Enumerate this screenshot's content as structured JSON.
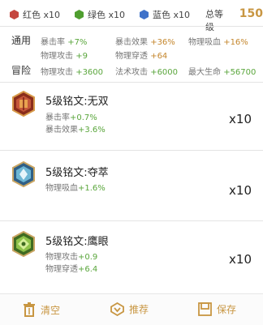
{
  "gems": [
    {
      "label": "红色 x10",
      "color": "#c5463f"
    },
    {
      "label": "绿色 x10",
      "color": "#4f9e2f"
    },
    {
      "label": "蓝色 x10",
      "color": "#3f72c9"
    }
  ],
  "total": {
    "label": "总等级",
    "value": "150"
  },
  "stats": {
    "general_label": "通用",
    "adventure_label": "冒险",
    "row1": [
      {
        "name": "暴击率 ",
        "value": "+7%"
      },
      {
        "name": "暴击效果 ",
        "value": "+36%"
      },
      {
        "name": "物理吸血 ",
        "value": "+16%"
      }
    ],
    "row2": [
      {
        "name": "物理攻击 ",
        "value": "+9"
      },
      {
        "name": "物理穿透 ",
        "value": "+64"
      }
    ],
    "row3": [
      {
        "name": "物理攻击 ",
        "value": "+3600"
      },
      {
        "name": "法术攻击 ",
        "value": "+6000"
      },
      {
        "name": "最大生命 ",
        "value": "+56700"
      }
    ]
  },
  "runes": [
    {
      "title": "5级铭文:无双",
      "count": "x10",
      "lines": [
        {
          "name": "暴击率",
          "value": "+0.7%"
        },
        {
          "name": "暴击效果",
          "value": "+3.6%"
        }
      ]
    },
    {
      "title": "5级铭文:夺萃",
      "count": "x10",
      "lines": [
        {
          "name": "物理吸血",
          "value": "+1.6%"
        }
      ]
    },
    {
      "title": "5级铭文:鹰眼",
      "count": "x10",
      "lines": [
        {
          "name": "物理攻击",
          "value": "+0.9"
        },
        {
          "name": "物理穿透",
          "value": "+6.4"
        }
      ]
    }
  ],
  "actions": {
    "clear": "清空",
    "recommend": "推荐",
    "save": "保存"
  }
}
